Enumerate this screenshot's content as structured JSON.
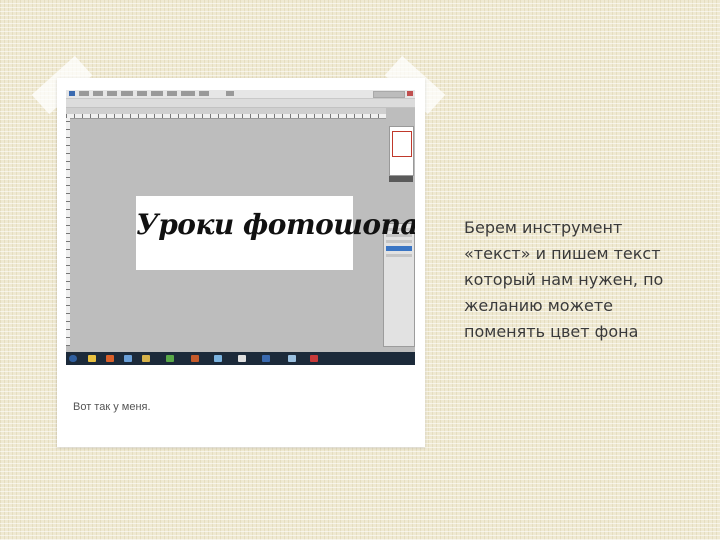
{
  "screenshot": {
    "document_text": "Уроки фотошопа",
    "taskbar_icons": [
      "start-orb-icon",
      "ie-icon",
      "firefox-icon",
      "photoshop-icon",
      "folder-icon",
      "chrome-icon",
      "media-icon",
      "skype-icon",
      "mail-icon",
      "word-icon",
      "app-icon",
      "app-icon"
    ]
  },
  "caption": "Вот так у меня.",
  "side_text_lines": [
    "Берем инструмент",
    "«текст» и пишем текст",
    "который нам нужен, по",
    "желанию можете",
    "поменять цвет фона"
  ]
}
